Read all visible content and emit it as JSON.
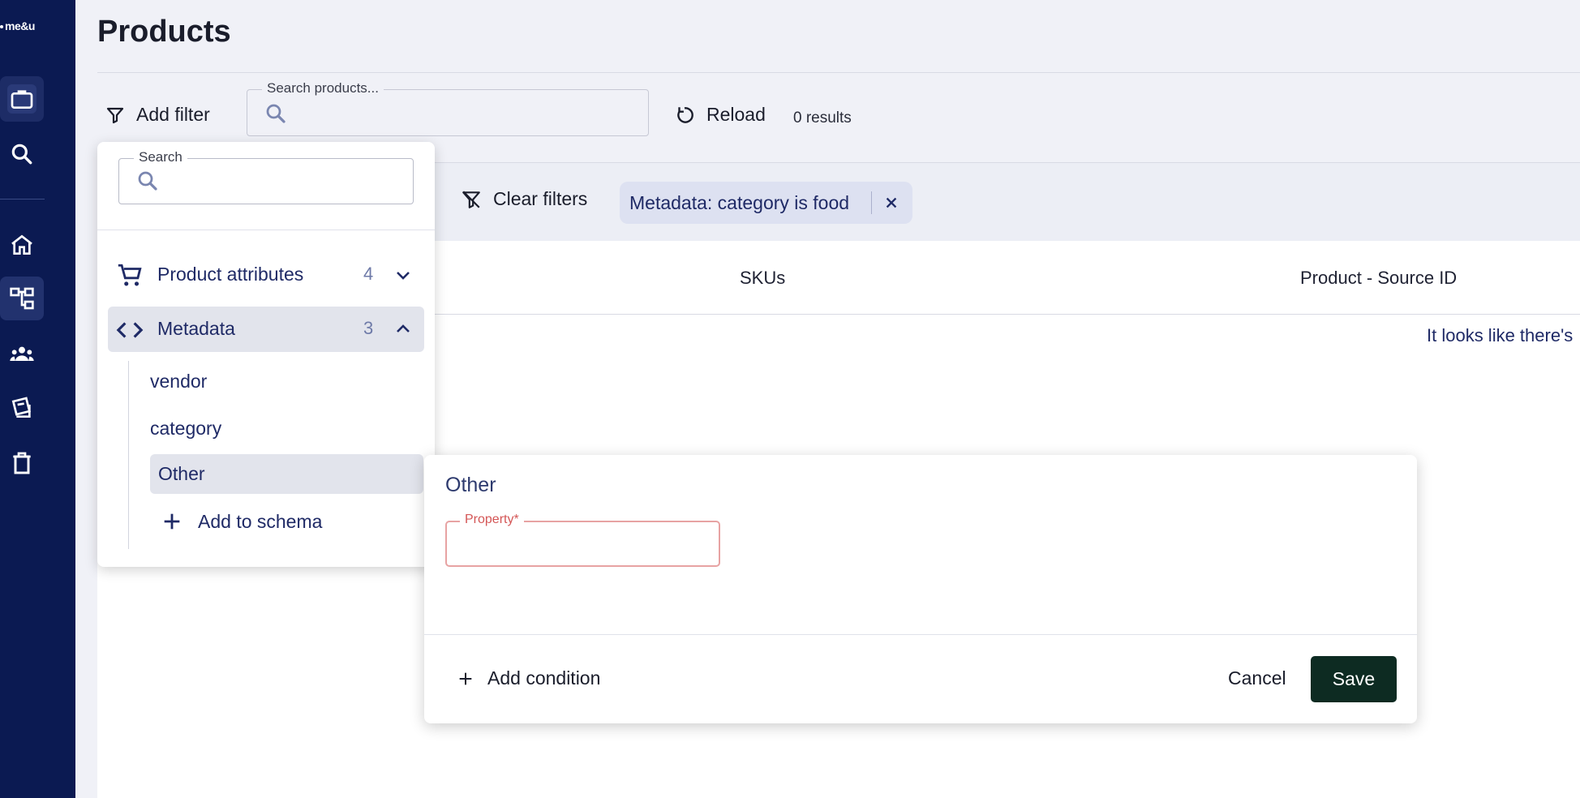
{
  "brand": {
    "logo_text": "me&u"
  },
  "page": {
    "title": "Products"
  },
  "toolbar": {
    "add_filter_label": "Add filter",
    "search_legend": "Search products...",
    "reload_label": "Reload",
    "results_text": "0 results"
  },
  "filters": {
    "clear_label": "Clear filters",
    "active_chip": "Metadata: category is food"
  },
  "table": {
    "columns": [
      "SKUs",
      "Product - Source ID"
    ],
    "empty_message": "It looks like there's"
  },
  "filter_panel": {
    "search_legend": "Search",
    "groups": [
      {
        "label": "Product attributes",
        "count": "4"
      },
      {
        "label": "Metadata",
        "count": "3"
      }
    ],
    "metadata_items": [
      "vendor",
      "category",
      "Other"
    ],
    "add_to_schema_label": "Add to schema"
  },
  "condition_editor": {
    "title": "Other",
    "property_legend": "Property*",
    "add_condition_label": "Add condition",
    "cancel_label": "Cancel",
    "save_label": "Save"
  },
  "colors": {
    "sidebar": "#0b1a52",
    "save": "#0d2b22",
    "chip": "#dde1f1",
    "error": "#d45656"
  }
}
